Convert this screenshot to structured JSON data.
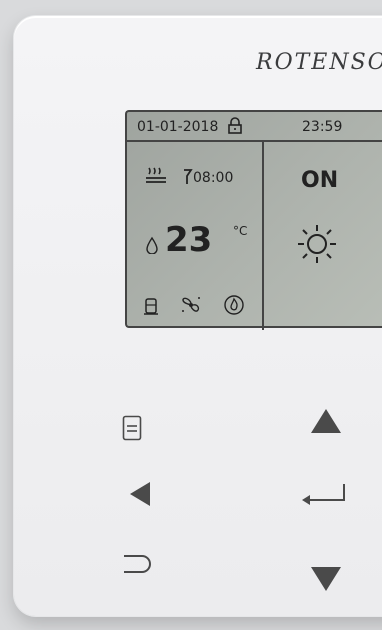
{
  "device": {
    "brand": "ROTENSO"
  },
  "display": {
    "date": "01-01-2018",
    "time": "23:59",
    "schedule_time": "08:00",
    "temperature": "23",
    "temperature_unit": "°C",
    "power_state": "ON",
    "mode_icon": "sun-icon",
    "status_icons": [
      "heating-schedule-icon",
      "timer-icon",
      "water-drop-icon",
      "water-tank-icon",
      "fan-icon",
      "flame-icon",
      "lock-icon"
    ]
  },
  "buttons": {
    "icons": [
      "menu-icon",
      "left-arrow-icon",
      "back-icon",
      "up-arrow-icon",
      "enter-icon",
      "down-arrow-icon"
    ]
  }
}
